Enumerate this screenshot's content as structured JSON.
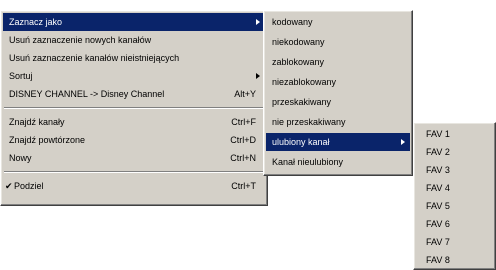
{
  "main_menu": {
    "items": [
      {
        "label": "Zaznacz jako"
      },
      {
        "label": "Usuń zaznaczenie nowych kanałów"
      },
      {
        "label": "Usuń zaznaczenie kanałów nieistniejących"
      },
      {
        "label": "Sortuj"
      },
      {
        "label": "DISNEY CHANNEL -> Disney Channel",
        "shortcut": "Alt+Y"
      },
      {
        "label": "Znajdź kanały",
        "shortcut": "Ctrl+F"
      },
      {
        "label": "Znajdź powtórzone",
        "shortcut": "Ctrl+D"
      },
      {
        "label": "Nowy",
        "shortcut": "Ctrl+N"
      },
      {
        "label": "Podziel",
        "shortcut": "Ctrl+T",
        "check": "✔"
      }
    ]
  },
  "sub_menu": {
    "items": [
      {
        "label": "kodowany"
      },
      {
        "label": "niekodowany"
      },
      {
        "label": "zablokowany"
      },
      {
        "label": "niezablokowany"
      },
      {
        "label": "przeskakiwany"
      },
      {
        "label": "nie przeskakiwany"
      },
      {
        "label": "ulubiony kanał"
      },
      {
        "label": "Kanał nieulubiony"
      }
    ]
  },
  "fav_menu": {
    "items": [
      {
        "label": "FAV 1"
      },
      {
        "label": "FAV 2"
      },
      {
        "label": "FAV 3"
      },
      {
        "label": "FAV 4"
      },
      {
        "label": "FAV 5"
      },
      {
        "label": "FAV 6"
      },
      {
        "label": "FAV 7"
      },
      {
        "label": "FAV 8"
      }
    ]
  }
}
